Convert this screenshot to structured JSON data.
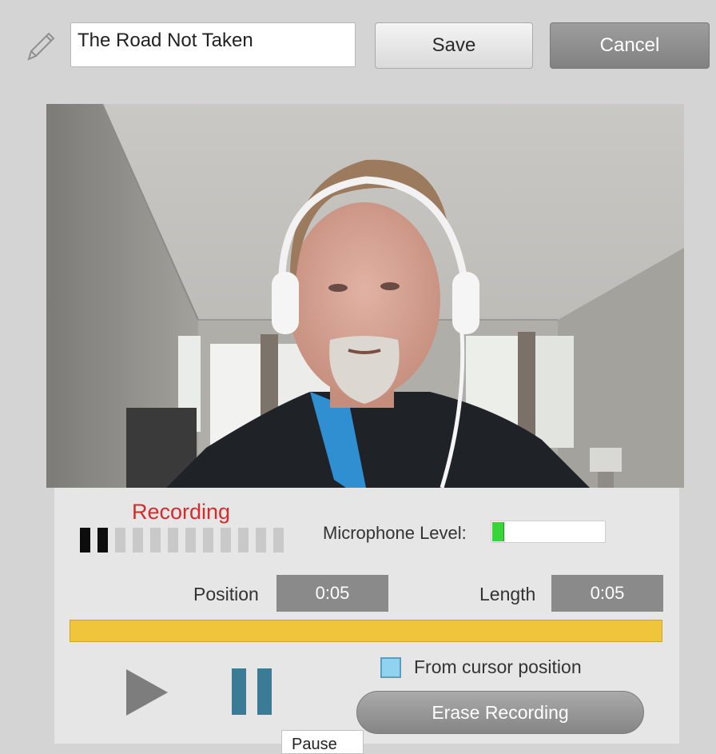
{
  "header": {
    "title_value": "The Road Not Taken",
    "save_label": "Save",
    "cancel_label": "Cancel",
    "edit_icon": "pencil-icon"
  },
  "video": {
    "subject": "webcam-preview"
  },
  "recorder": {
    "status_label": "Recording",
    "status_color": "#d52b2b",
    "level_segments_total": 12,
    "level_segments_active": 2,
    "mic_label": "Microphone Level:",
    "mic_level": 0.1,
    "mic_color": "#39d33a",
    "position_label": "Position",
    "position_value": "0:05",
    "length_label": "Length",
    "length_value": "0:05",
    "timeline_color": "#f1c53b",
    "play_icon": "play-icon",
    "pause_icon": "pause-icon",
    "pause_color": "#3c7a96",
    "cursor_checkbox_label": "From cursor position",
    "erase_label": "Erase Recording",
    "tooltip_text": "Pause"
  }
}
